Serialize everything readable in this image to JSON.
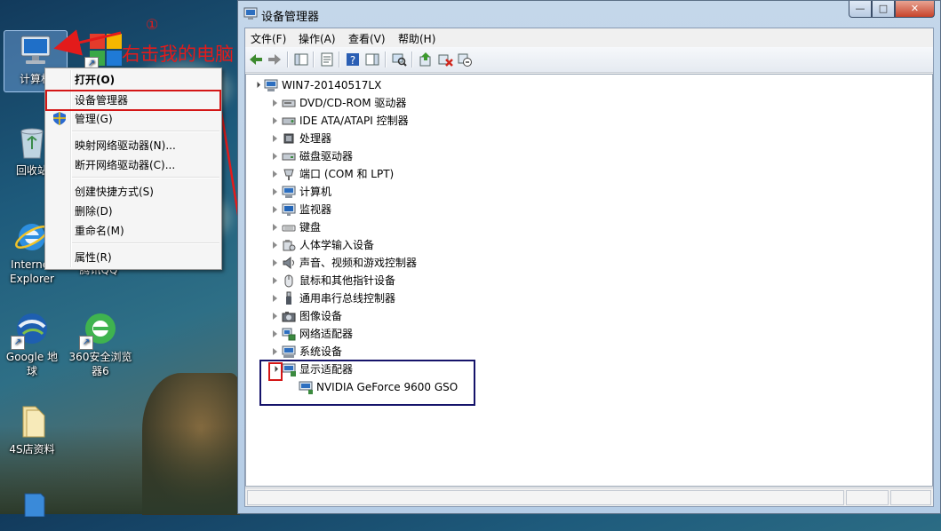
{
  "desktop": {
    "icons": [
      {
        "label": "计算机",
        "icon": "computer-icon"
      },
      {
        "label": "回收站",
        "icon": "recycle-bin-icon"
      },
      {
        "label": "Internet Explorer",
        "icon": "ie-icon"
      },
      {
        "label": "腾讯QQ",
        "icon": "qq-icon"
      },
      {
        "label": "Google 地球",
        "icon": "google-earth-icon"
      },
      {
        "label": "360安全浏览器6",
        "icon": "360-browser-icon"
      },
      {
        "label": "4S店资料",
        "icon": "folder-icon"
      },
      {
        "label": "",
        "icon": "app-icon"
      }
    ]
  },
  "annotation": {
    "number": "①",
    "text": "右击我的电脑",
    "color": "#e31b1b"
  },
  "context_menu": {
    "items": [
      {
        "label": "打开(O)",
        "bold": true
      },
      {
        "label": "设备管理器",
        "highlighted": true
      },
      {
        "label": "管理(G)",
        "icon": "shield-icon"
      },
      {
        "label": "映射网络驱动器(N)..."
      },
      {
        "label": "断开网络驱动器(C)..."
      },
      {
        "label": "创建快捷方式(S)"
      },
      {
        "label": "删除(D)"
      },
      {
        "label": "重命名(M)"
      },
      {
        "label": "属性(R)"
      }
    ]
  },
  "window": {
    "title": "设备管理器",
    "controls": {
      "minimize": "—",
      "maximize": "□",
      "close": "✕"
    },
    "menu": [
      "文件(F)",
      "操作(A)",
      "查看(V)",
      "帮助(H)"
    ],
    "toolbar_icons": [
      "back-arrow-icon",
      "forward-arrow-icon",
      "console-tree-icon",
      "properties-icon",
      "help-icon",
      "action-pane-icon",
      "scan-hardware-icon",
      "update-driver-icon",
      "uninstall-icon",
      "disable-icon"
    ],
    "tree": {
      "root": "WIN7-20140517LX",
      "categories": [
        {
          "label": "DVD/CD-ROM 驱动器",
          "icon": "dvd-drive-icon"
        },
        {
          "label": "IDE ATA/ATAPI 控制器",
          "icon": "ide-controller-icon"
        },
        {
          "label": "处理器",
          "icon": "processor-icon"
        },
        {
          "label": "磁盘驱动器",
          "icon": "disk-drive-icon"
        },
        {
          "label": "端口 (COM 和 LPT)",
          "icon": "port-icon"
        },
        {
          "label": "计算机",
          "icon": "computer-icon"
        },
        {
          "label": "监视器",
          "icon": "monitor-icon"
        },
        {
          "label": "键盘",
          "icon": "keyboard-icon"
        },
        {
          "label": "人体学输入设备",
          "icon": "hid-icon"
        },
        {
          "label": "声音、视频和游戏控制器",
          "icon": "sound-icon"
        },
        {
          "label": "鼠标和其他指针设备",
          "icon": "mouse-icon"
        },
        {
          "label": "通用串行总线控制器",
          "icon": "usb-icon"
        },
        {
          "label": "图像设备",
          "icon": "imaging-icon"
        },
        {
          "label": "网络适配器",
          "icon": "network-adapter-icon"
        },
        {
          "label": "系统设备",
          "icon": "system-device-icon"
        },
        {
          "label": "显示适配器",
          "icon": "display-adapter-icon",
          "expanded": true
        }
      ],
      "expanded_child": "NVIDIA GeForce 9600 GSO"
    }
  }
}
